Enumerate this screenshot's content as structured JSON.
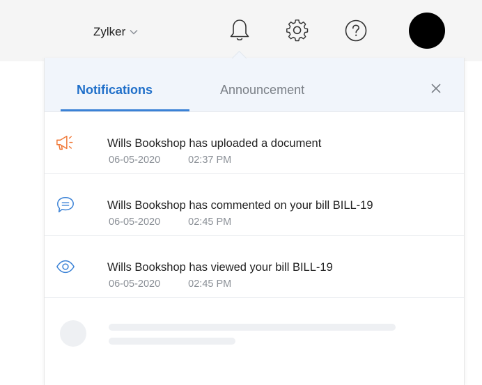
{
  "topbar": {
    "org_name": "Zylker",
    "icons": [
      "chevron-down-icon",
      "bell-icon",
      "gear-icon",
      "help-icon"
    ],
    "avatar_color": "#000000"
  },
  "panel": {
    "tabs": [
      {
        "label": "Notifications",
        "active": true
      },
      {
        "label": "Announcement",
        "active": false
      }
    ],
    "close_label": "×",
    "accent_color": "#1f6fc9",
    "notifications": [
      {
        "icon": "megaphone-icon",
        "icon_color": "#f07a3a",
        "text": "Wills Bookshop has uploaded a document",
        "date": "06-05-2020",
        "time": "02:37 PM"
      },
      {
        "icon": "comment-icon",
        "icon_color": "#3b82d6",
        "text": "Wills Bookshop has commented on your bill BILL-19",
        "date": "06-05-2020",
        "time": "02:45 PM"
      },
      {
        "icon": "eye-icon",
        "icon_color": "#3b82d6",
        "text": "Wills Bookshop has viewed your bill BILL-19",
        "date": "06-05-2020",
        "time": "02:45 PM"
      }
    ]
  }
}
